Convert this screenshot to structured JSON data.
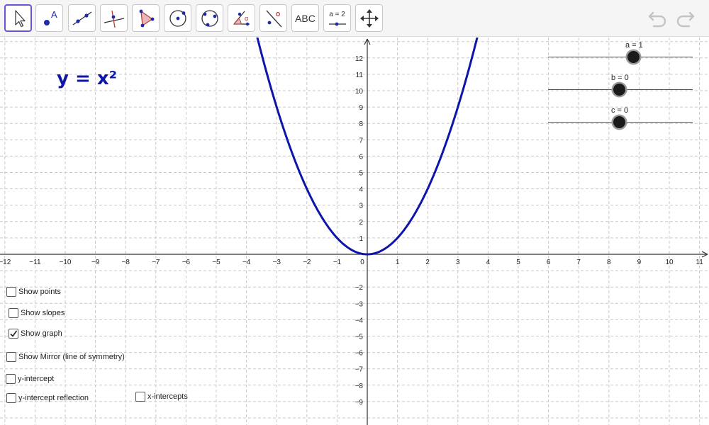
{
  "toolbar": {
    "tools": [
      {
        "id": "move",
        "active": true
      },
      {
        "id": "point",
        "label": "A"
      },
      {
        "id": "line"
      },
      {
        "id": "perpendicular-line"
      },
      {
        "id": "polygon"
      },
      {
        "id": "circle-center-point"
      },
      {
        "id": "circle-three-points"
      },
      {
        "id": "angle",
        "label": "α"
      },
      {
        "id": "reflect"
      },
      {
        "id": "text",
        "label": "ABC"
      },
      {
        "id": "slider",
        "label": "a = 2"
      },
      {
        "id": "move-graphics-view"
      }
    ],
    "undo_icon": "undo-icon",
    "redo_icon": "redo-icon"
  },
  "graph": {
    "formula": "y = x²",
    "curve_color": "#0d16a8",
    "x_axis": {
      "min": -12,
      "max": 11,
      "labels": [
        "−12",
        "−11",
        "−10",
        "−9",
        "−8",
        "−7",
        "−6",
        "−5",
        "−4",
        "−3",
        "−2",
        "−1",
        "0",
        "1",
        "2",
        "3",
        "4",
        "5",
        "6",
        "7",
        "8",
        "9",
        "10",
        "11"
      ]
    },
    "y_axis": {
      "labels_positive": [
        "1",
        "2",
        "3",
        "4",
        "5",
        "6",
        "7",
        "8",
        "9",
        "10",
        "11",
        "12"
      ],
      "labels_negative": [
        "−2",
        "−3",
        "−4",
        "−5",
        "−6",
        "−7",
        "−8",
        "−9"
      ]
    },
    "a": 1,
    "b": 0,
    "c": 0
  },
  "sliders": [
    {
      "label": "a = 1",
      "value": 1
    },
    {
      "label": "b = 0",
      "value": 0
    },
    {
      "label": "c = 0",
      "value": 0
    }
  ],
  "checkboxes": [
    {
      "label": "Show points",
      "checked": false
    },
    {
      "label": "Show slopes",
      "checked": false
    },
    {
      "label": "Show graph",
      "checked": true
    },
    {
      "label": "Show Mirror (line of symmetry)",
      "checked": false
    },
    {
      "label": "y-intercept",
      "checked": false
    },
    {
      "label": "y-intercept reflection",
      "checked": false
    },
    {
      "label": "x-intercepts",
      "checked": false
    }
  ]
}
